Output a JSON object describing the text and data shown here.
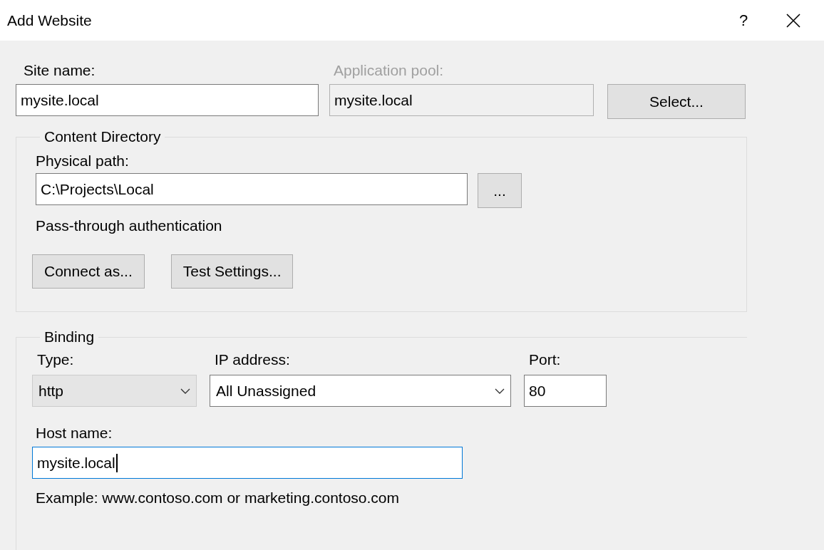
{
  "window": {
    "title": "Add Website",
    "help": "?"
  },
  "site": {
    "label": "Site name:",
    "value": "mysite.local"
  },
  "app_pool": {
    "label": "Application pool:",
    "value": "mysite.local",
    "disabled": true,
    "button": "Select..."
  },
  "content_directory": {
    "title": "Content Directory",
    "path_label": "Physical path:",
    "path_value": "C:\\Projects\\Local",
    "browse": "...",
    "auth_text": "Pass-through authentication",
    "buttons": [
      "Connect as...",
      "Test Settings..."
    ]
  },
  "binding": {
    "title": "Binding",
    "type": {
      "label": "Type:",
      "value": "http",
      "editable": false
    },
    "ip": {
      "label": "IP address:",
      "value": "All Unassigned",
      "editable": true
    },
    "port": {
      "label": "Port:",
      "value": "80"
    },
    "host": {
      "label": "Host name:",
      "value": "mysite.local",
      "focused": true
    },
    "example": "Example: www.contoso.com or marketing.contoso.com"
  }
}
